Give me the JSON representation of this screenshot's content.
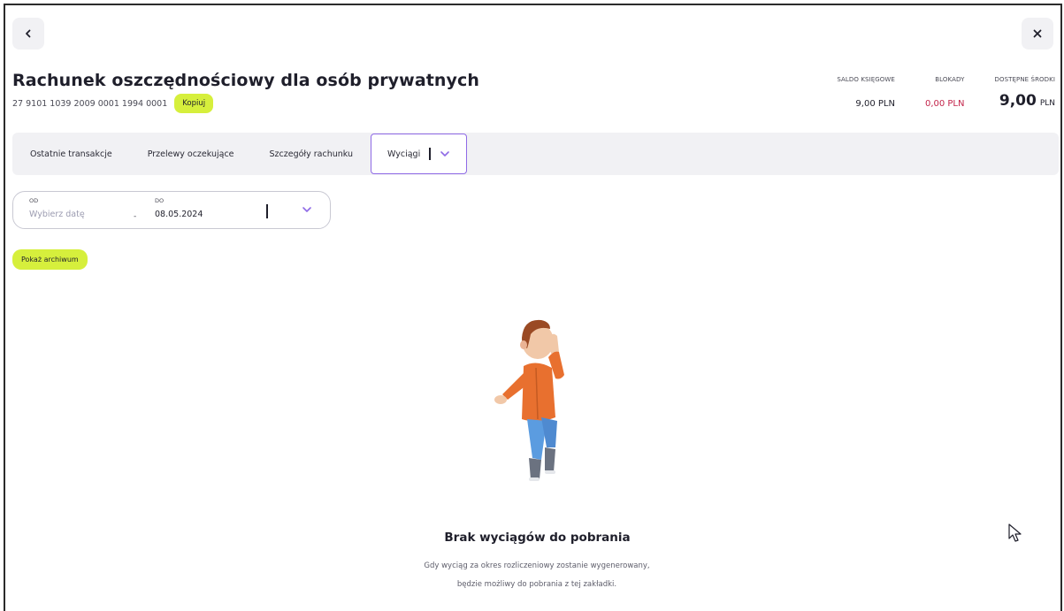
{
  "header": {
    "back_icon": "chevron-left-icon",
    "close_icon": "close-icon",
    "title": "Rachunek oszczędnościowy dla osób prywatnych",
    "account_number": "27 9101 1039 2009 0001 1994 0001",
    "copy_label": "Kopiuj"
  },
  "balances": {
    "book_balance_label": "SALDO KSIĘGOWE",
    "book_balance_value": "9,00 PLN",
    "blocks_label": "BLOKADY",
    "blocks_value": "0,00 PLN",
    "available_label": "DOSTĘPNE ŚRODKI",
    "available_amount": "9,00",
    "available_currency": "PLN"
  },
  "tabs": [
    {
      "label": "Ostatnie transakcje"
    },
    {
      "label": "Przelewy oczekujące"
    },
    {
      "label": "Szczegóły rachunku"
    },
    {
      "label": "Wyciągi",
      "active": true
    }
  ],
  "date_range": {
    "from_label": "OD",
    "from_placeholder": "Wybierz datę",
    "to_label": "DO",
    "to_value": "08.05.2024",
    "dash": "-"
  },
  "archive_button": "Pokaż archiwum",
  "empty_state": {
    "title": "Brak wyciągów do pobrania",
    "description": "Gdy wyciąg za okres rozliczeniowy zostanie wygenerowany, będzie możliwy do pobrania z tej zakładki."
  },
  "colors": {
    "accent_lime": "#d6ef3c",
    "accent_purple": "#8f6ae6",
    "negative_red": "#c3244a"
  }
}
